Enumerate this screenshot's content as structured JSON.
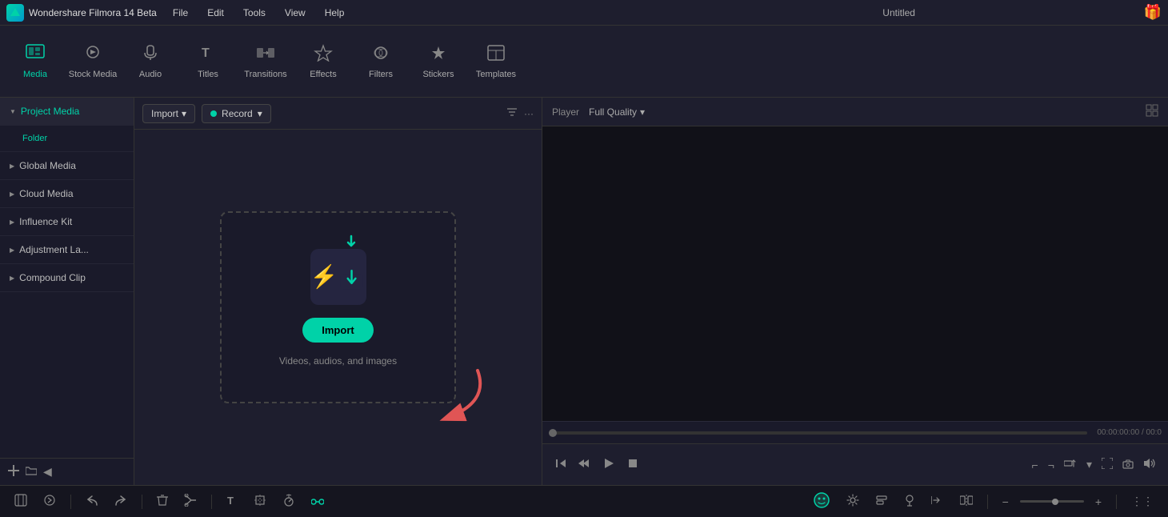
{
  "app": {
    "name": "Wondershare Filmora 14 Beta",
    "title": "Untitled"
  },
  "menu": {
    "items": [
      "File",
      "Edit",
      "Tools",
      "View",
      "Help"
    ]
  },
  "toolbar": {
    "buttons": [
      {
        "id": "media",
        "label": "Media",
        "icon": "▦",
        "active": true
      },
      {
        "id": "stock-media",
        "label": "Stock Media",
        "icon": "🎵"
      },
      {
        "id": "audio",
        "label": "Audio",
        "icon": "♪"
      },
      {
        "id": "titles",
        "label": "Titles",
        "icon": "T"
      },
      {
        "id": "transitions",
        "label": "Transitions",
        "icon": "↔"
      },
      {
        "id": "effects",
        "label": "Effects",
        "icon": "✦"
      },
      {
        "id": "filters",
        "label": "Filters",
        "icon": "◈"
      },
      {
        "id": "stickers",
        "label": "Stickers",
        "icon": "★"
      },
      {
        "id": "templates",
        "label": "Templates",
        "icon": "⊞"
      }
    ]
  },
  "sidebar": {
    "items": [
      {
        "id": "project-media",
        "label": "Project Media",
        "indent": false
      },
      {
        "id": "folder",
        "label": "Folder",
        "indent": true
      },
      {
        "id": "global-media",
        "label": "Global Media",
        "indent": false
      },
      {
        "id": "cloud-media",
        "label": "Cloud Media",
        "indent": false
      },
      {
        "id": "influence-kit",
        "label": "Influence Kit",
        "indent": false
      },
      {
        "id": "adjustment-layer",
        "label": "Adjustment La...",
        "indent": false
      },
      {
        "id": "compound-clip",
        "label": "Compound Clip",
        "indent": false
      }
    ]
  },
  "media_toolbar": {
    "import_label": "Import",
    "record_label": "Record",
    "filter_icon": "filter",
    "more_icon": "more"
  },
  "drop_zone": {
    "import_button": "Import",
    "hint_text": "Videos, audios, and images"
  },
  "player": {
    "label": "Player",
    "quality": "Full Quality",
    "time": "00:00:00:00",
    "separator": "/",
    "end_time": "00:0"
  },
  "timeline": {
    "zoom_minus": "−",
    "zoom_plus": "+"
  }
}
